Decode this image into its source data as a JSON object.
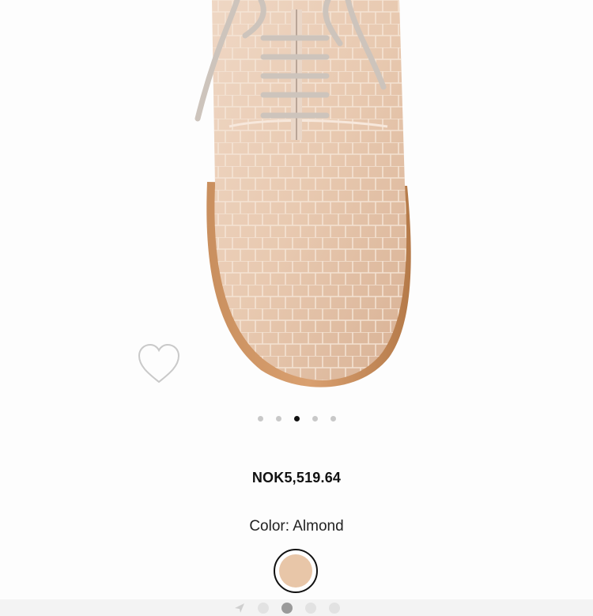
{
  "product": {
    "price": "NOK5,519.64",
    "color_label": "Color:",
    "color_value": "Almond",
    "image": {
      "subject": "Almond croc-embossed leather lace-up oxford shoe, top-down view",
      "color": "#e9ccb4"
    }
  },
  "gallery": {
    "dot_count": 5,
    "active_index": 2
  },
  "swatches": [
    {
      "name": "Almond",
      "color": "#e8c6a8",
      "selected": true
    }
  ],
  "icons": {
    "favorite": "heart-outline-icon",
    "location": "location-arrow-icon"
  },
  "bottom_indicator": {
    "dot_count": 4,
    "active_index": 1
  }
}
